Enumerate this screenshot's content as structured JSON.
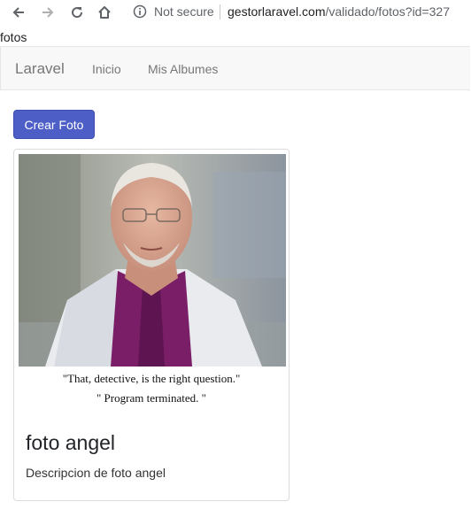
{
  "browser": {
    "security_label": "Not secure",
    "url_host": "gestorlaravel.com",
    "url_path": "/validado/fotos?id=327"
  },
  "page": {
    "heading_text": "fotos"
  },
  "navbar": {
    "brand": "Laravel",
    "links": [
      "Inicio",
      "Mis Albumes"
    ]
  },
  "actions": {
    "create_label": "Crear Foto"
  },
  "card": {
    "quote_line1": "\"That, detective, is the right question.\"",
    "quote_line2": "\" Program terminated. \"",
    "title": "foto angel",
    "description": "Descripcion de foto angel"
  },
  "colors": {
    "primary_button": "#4d5fc7",
    "navbar_bg": "#f8f8f8"
  }
}
